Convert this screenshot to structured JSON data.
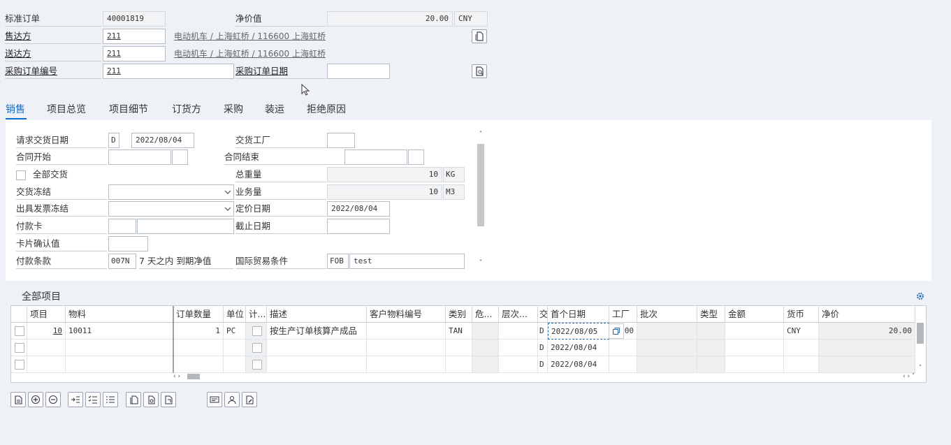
{
  "header": {
    "order_type": "标准订单",
    "order_no": "40001819",
    "net_value_label": "净价值",
    "net_value": "20.00",
    "currency": "CNY",
    "sold_to_label": "售达方",
    "sold_to": "211",
    "sold_to_desc": "电动机车 / 上海虹桥 / 116600 上海虹桥",
    "ship_to_label": "送达方",
    "ship_to": "211",
    "ship_to_desc": "电动机车 / 上海虹桥 / 116600 上海虹桥",
    "po_no_label": "采购订单编号",
    "po_no": "211",
    "po_date_label": "采购订单日期",
    "po_date": ""
  },
  "tabs": [
    "销售",
    "项目总览",
    "项目细节",
    "订货方",
    "采购",
    "装运",
    "拒绝原因"
  ],
  "sales": {
    "req_delivery_date_label": "请求交货日期",
    "req_delivery_date_type": "D",
    "req_delivery_date": "2022/08/04",
    "delivery_plant_label": "交货工厂",
    "contract_start_label": "合同开始",
    "contract_end_label": "合同结束",
    "complete_delivery_label": "全部交货",
    "total_weight_label": "总重量",
    "total_weight": "10",
    "weight_unit": "KG",
    "delivery_block_label": "交货冻结",
    "volume_label": "业务量",
    "volume": "10",
    "volume_unit": "M3",
    "billing_block_label": "出具发票冻结",
    "pricing_date_label": "定价日期",
    "pricing_date": "2022/08/04",
    "payment_card_label": "付款卡",
    "expiry_date_label": "截止日期",
    "card_verify_label": "卡片确认值",
    "payment_terms_label": "付款条款",
    "payment_terms": "007N",
    "payment_terms_desc": "7 天之内 到期净值",
    "incoterms_label": "国际贸易条件",
    "incoterms": "FOB",
    "incoterms_loc": "test"
  },
  "items": {
    "title": "全部项目",
    "columns": [
      "项目",
      "物料",
      "订单数量",
      "单位",
      "计...",
      "描述",
      "客户物料编号",
      "类别",
      "危...",
      "层次...",
      "交",
      "首个日期",
      "工厂",
      "批次",
      "类型",
      "金额",
      "货币",
      "净价"
    ],
    "rows": [
      {
        "item": "10",
        "material": "10011",
        "qty": "1",
        "unit": "PC",
        "desc": "按生产订单核算产成品",
        "category": "TAN",
        "dtype": "D",
        "first_date": "2022/08/05",
        "plant": "00",
        "currency": "CNY",
        "net_price": "20.00"
      },
      {
        "item": "",
        "material": "",
        "qty": "",
        "unit": "",
        "desc": "",
        "category": "",
        "dtype": "D",
        "first_date": "2022/08/04",
        "plant": "",
        "currency": "",
        "net_price": ""
      },
      {
        "item": "",
        "material": "",
        "qty": "",
        "unit": "",
        "desc": "",
        "category": "",
        "dtype": "D",
        "first_date": "2022/08/04",
        "plant": "",
        "currency": "",
        "net_price": ""
      }
    ]
  },
  "icons": {
    "sold_to_detail": "document-icon",
    "po_detail": "document-search-icon",
    "settings": "gear-icon"
  }
}
